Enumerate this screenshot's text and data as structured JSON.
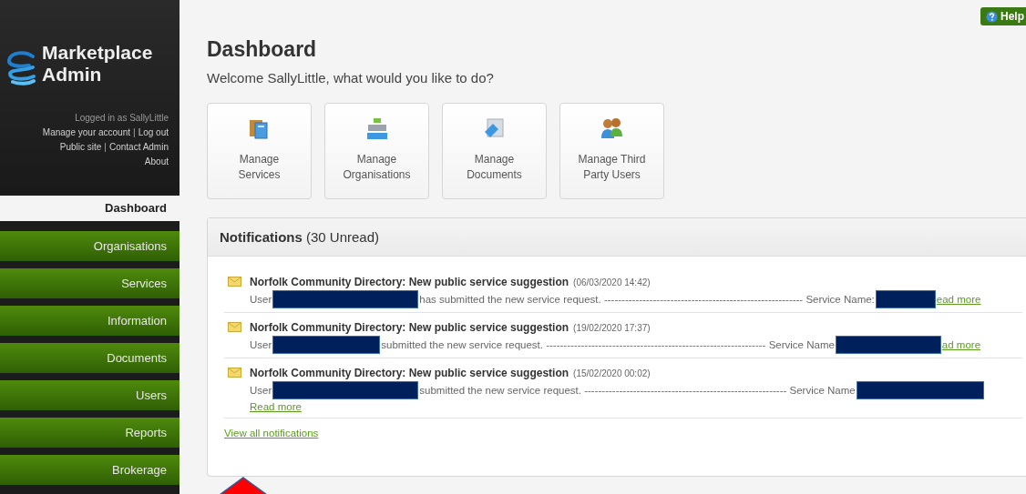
{
  "sidebar": {
    "brand": [
      "Marketplace",
      "Admin"
    ],
    "account_links": [
      {
        "kind": "text",
        "label": "Logged in as SallyLittle"
      },
      {
        "kind": "links",
        "items": [
          "Manage your account",
          "Log out"
        ],
        "separator": "|"
      },
      {
        "kind": "links",
        "items": [
          "Public site",
          "Contact Admin"
        ],
        "separator": "|"
      },
      {
        "kind": "links",
        "items": [
          "About"
        ]
      }
    ],
    "items": [
      {
        "label": "Dashboard",
        "selected": true
      },
      {
        "label": "Organisations",
        "selected": false
      },
      {
        "label": "Services",
        "selected": false
      },
      {
        "label": "Information",
        "selected": false
      },
      {
        "label": "Documents",
        "selected": false
      },
      {
        "label": "Users",
        "selected": false
      },
      {
        "label": "Reports",
        "selected": false
      },
      {
        "label": "Brokerage",
        "selected": false
      }
    ]
  },
  "help_button": "Help",
  "page": {
    "title": "Dashboard",
    "welcome": "Welcome SallyLittle, what would you like to do?"
  },
  "tiles": [
    {
      "kind": "services",
      "label": "Manage Services"
    },
    {
      "kind": "organisations",
      "label": "Manage Organisations"
    },
    {
      "kind": "documents",
      "label": "Manage Documents"
    },
    {
      "kind": "users",
      "label": "Manage Third Party Users"
    }
  ],
  "notifications": {
    "header": "**Notifications** (30 Unread)",
    "items": [
      {
        "title": "Norfolk Community Directory: New public service suggestion",
        "time": "(06/03/2020 14:42)",
        "prefix": "User",
        "text": "has submitted the new service request. --------------------------------------------------------- Service Name:",
        "link": "ead more",
        "link_wrapped": false
      },
      {
        "title": "Norfolk Community Directory: New public service suggestion",
        "time": "(19/02/2020 17:37)",
        "prefix": "User",
        "text": "submitted the new service request. --------------------------------------------------------------- Service Name",
        "link": "ad more",
        "link_wrapped": false
      },
      {
        "title": "Norfolk Community Directory: New public service suggestion",
        "time": "(15/02/2020 00:02)",
        "prefix": "User",
        "text": "submitted the new service request. ---------------------------------------------------------- Service Name",
        "link": "Read more",
        "link_wrapped": true
      }
    ],
    "view_all": "View all notifications"
  }
}
